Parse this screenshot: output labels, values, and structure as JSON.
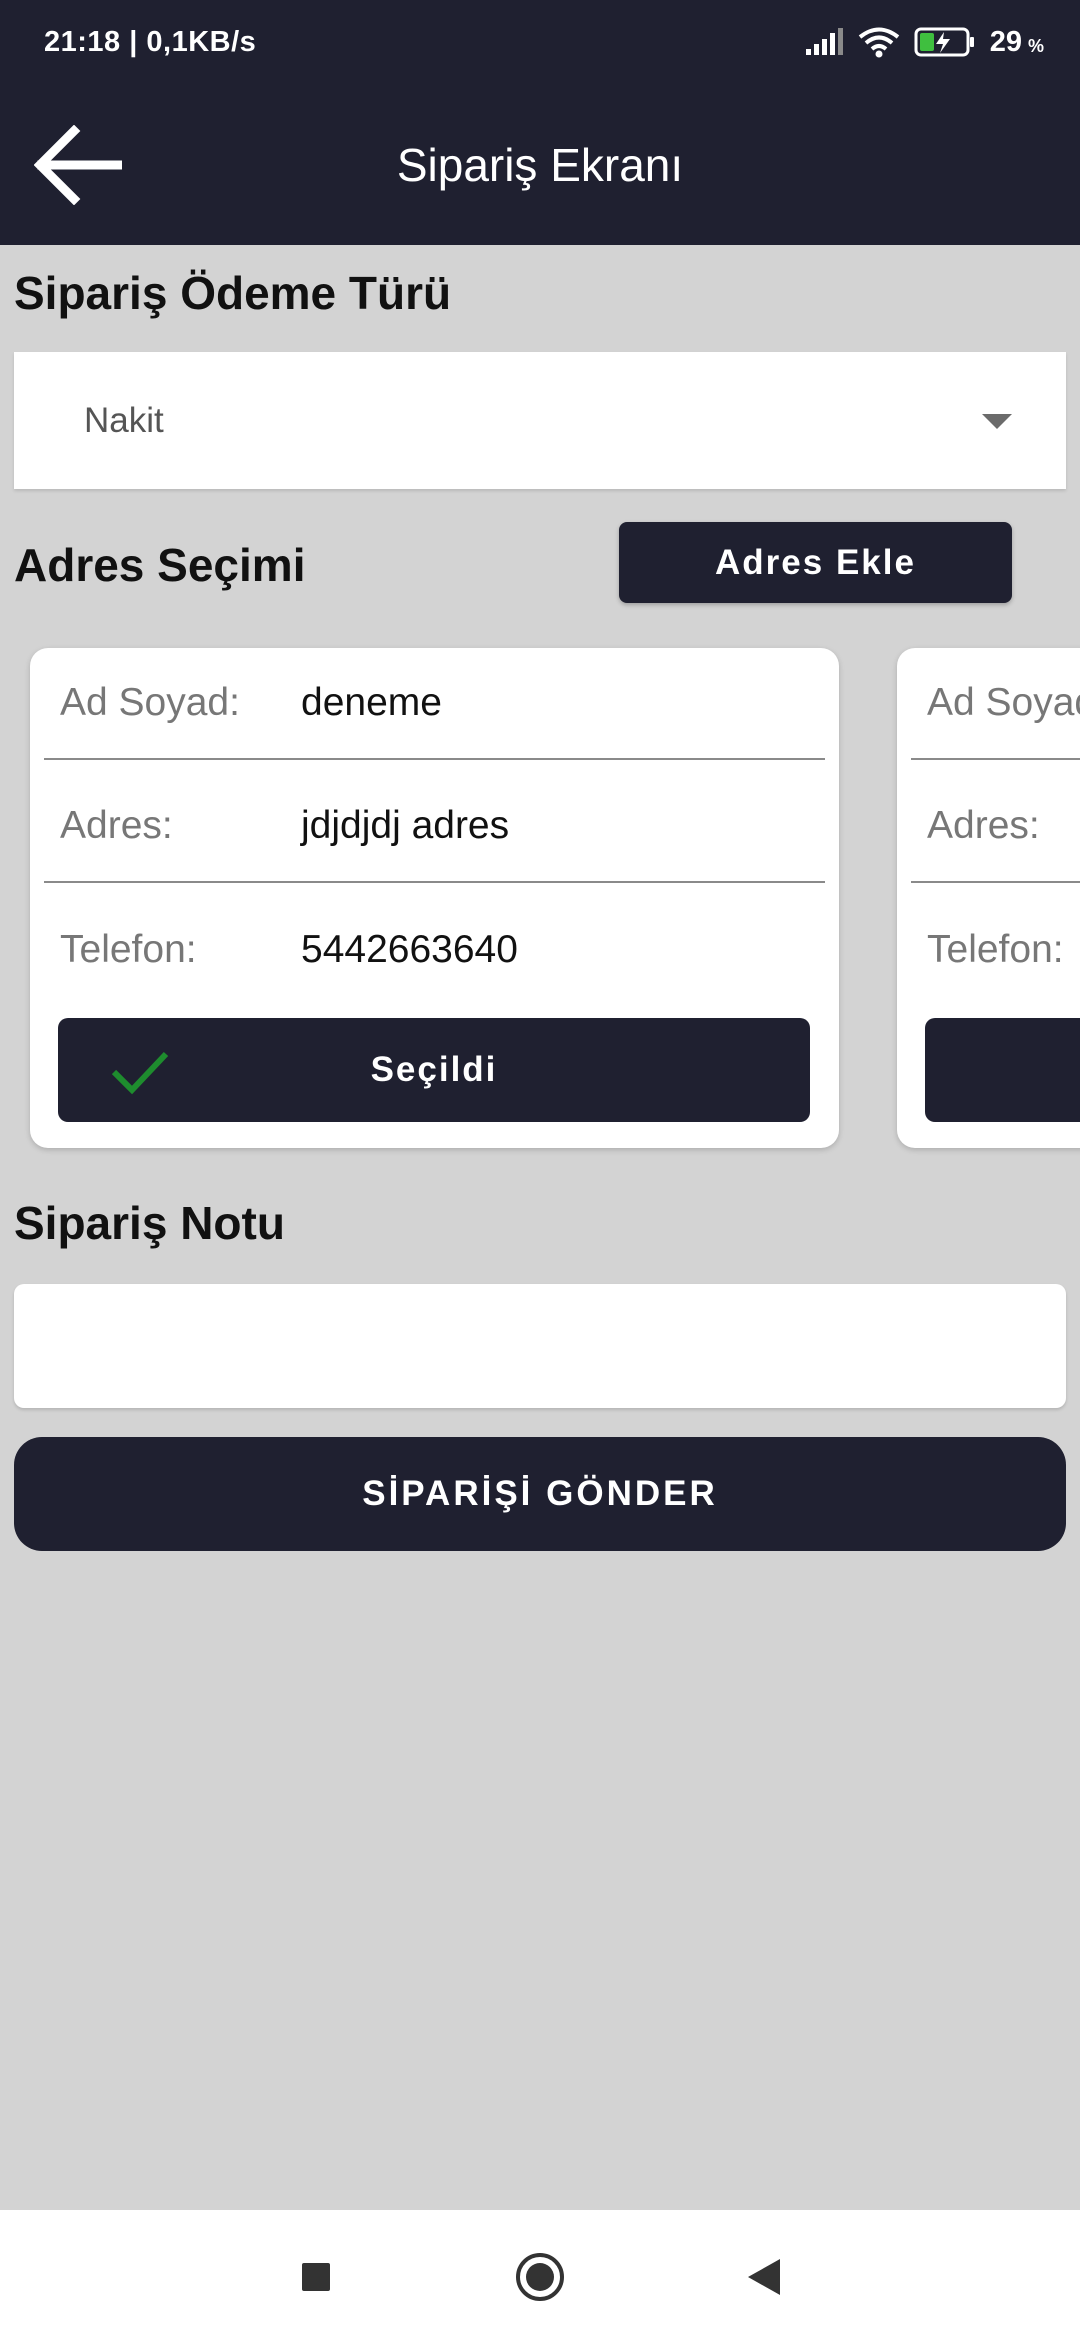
{
  "status_bar": {
    "time_speed": "21:18 | 0,1KB/s",
    "battery_value": "29",
    "battery_unit": "%",
    "icons": [
      "signal-icon",
      "wifi-icon",
      "battery-charging-icon"
    ]
  },
  "app_bar": {
    "title": "Sipariş Ekranı",
    "back_icon": "arrow-left-icon"
  },
  "payment": {
    "title": "Sipariş Ödeme Türü",
    "selected": "Nakit"
  },
  "address": {
    "title": "Adres Seçimi",
    "add_button": "Adres Ekle",
    "cards": [
      {
        "name_label": "Ad Soyad:",
        "name_value": "deneme",
        "address_label": "Adres:",
        "address_value": "jdjdjdj adres",
        "phone_label": "Telefon:",
        "phone_value": "5442663640",
        "button_label": "Seçildi",
        "selected": true
      },
      {
        "name_label": "Ad Soyad:",
        "address_label": "Adres:",
        "phone_label": "Telefon:"
      }
    ]
  },
  "note": {
    "title": "Sipariş Notu",
    "value": ""
  },
  "submit": {
    "label": "SİPARİŞİ GÖNDER"
  },
  "colors": {
    "dark": "#1f2030",
    "background": "#d3d3d3",
    "check": "#1e8c2e"
  },
  "nav_bar": {
    "icons": [
      "square-recents-icon",
      "circle-home-icon",
      "triangle-back-icon"
    ]
  }
}
